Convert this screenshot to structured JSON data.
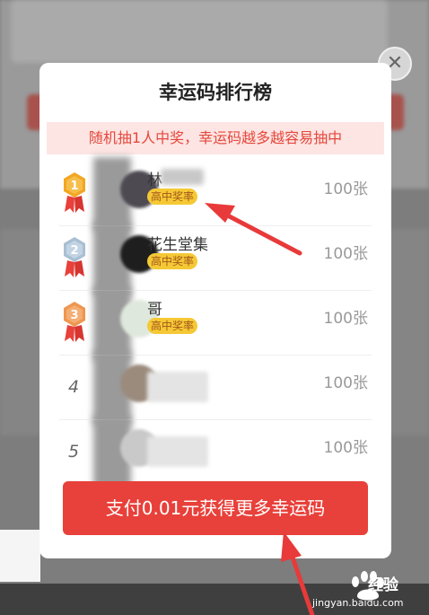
{
  "modal": {
    "title": "幸运码排行榜",
    "notice": "随机抽1人中奖，幸运码越多越容易抽中",
    "close_icon": "close-icon"
  },
  "ranking": [
    {
      "rank": "1",
      "rank_style": "gold-medal",
      "name_visible": "林",
      "tag": "高中奖率",
      "count": "100张"
    },
    {
      "rank": "2",
      "rank_style": "silver-medal",
      "name_visible": "花生堂集",
      "tag": "高中奖率",
      "count": "100张"
    },
    {
      "rank": "3",
      "rank_style": "bronze-medal",
      "name_visible": "哥",
      "tag": "高中奖率",
      "count": "100张"
    },
    {
      "rank": "4",
      "rank_style": "plain",
      "name_visible": "",
      "tag": "",
      "count": "100张"
    },
    {
      "rank": "5",
      "rank_style": "plain",
      "name_visible": "",
      "tag": "",
      "count": "100张"
    }
  ],
  "pay_button": {
    "label": "支付0.01元获得更多幸运码"
  },
  "watermark": {
    "brand": "经验",
    "url": "jingyan.baidu.com"
  },
  "colors": {
    "accent_red": "#e8403a",
    "notice_bg": "#fde5e3",
    "tag_yellow": "#f5c935",
    "arrow_red": "#e83a3a",
    "gold": "#f2a623",
    "silver": "#a9bfd3",
    "bronze": "#ee9650"
  }
}
